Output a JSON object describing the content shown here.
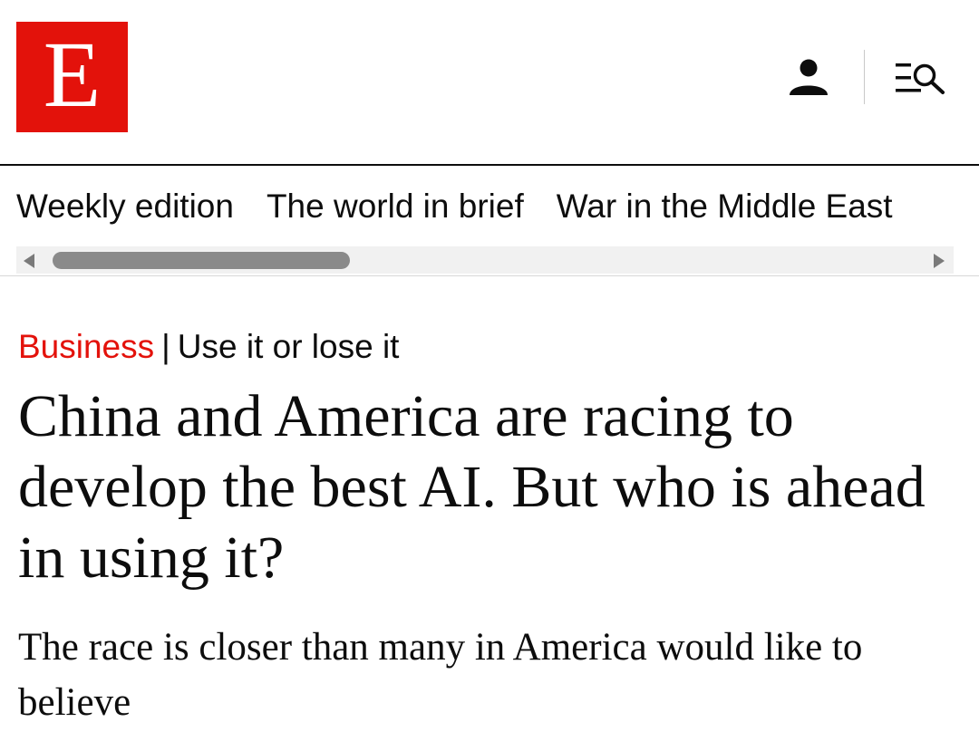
{
  "header": {
    "logo_letter": "E",
    "brand_color": "#e3120b",
    "user_icon": "user-icon",
    "menu_icon": "menu-search-icon"
  },
  "nav": {
    "items": [
      {
        "label": "Weekly edition"
      },
      {
        "label": "The world in brief"
      },
      {
        "label": "War in the Middle East"
      }
    ]
  },
  "article": {
    "section": "Business",
    "separator": "|",
    "flytitle": "Use it or lose it",
    "headline": "China and America are racing to develop the best AI. But who is ahead in using it?",
    "subheadline": "The race is closer than many in America would like to believe"
  }
}
